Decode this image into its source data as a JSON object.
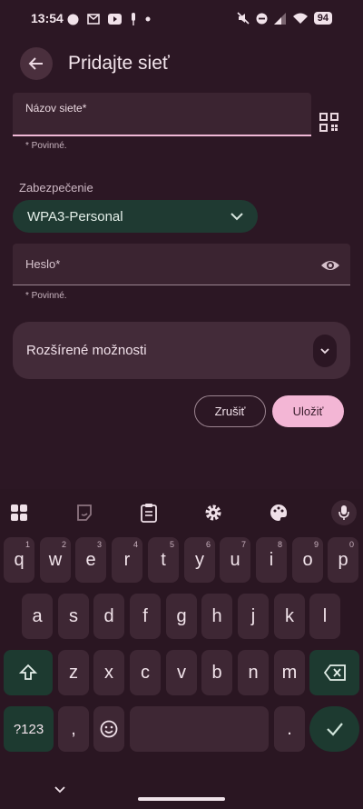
{
  "status_bar": {
    "time": "13:54",
    "battery": "94"
  },
  "header": {
    "title": "Pridajte sieť"
  },
  "form": {
    "ssid_label": "Názov siete*",
    "ssid_helper": "* Povinné.",
    "security_label": "Zabezpečenie",
    "security_value": "WPA3-Personal",
    "password_label": "Heslo*",
    "password_helper": "* Povinné.",
    "advanced_label": "Rozšírené možnosti",
    "cancel_label": "Zrušiť",
    "save_label": "Uložiť"
  },
  "keyboard": {
    "row1": [
      {
        "key": "q",
        "hint": "1"
      },
      {
        "key": "w",
        "hint": "2"
      },
      {
        "key": "e",
        "hint": "3"
      },
      {
        "key": "r",
        "hint": "4"
      },
      {
        "key": "t",
        "hint": "5"
      },
      {
        "key": "y",
        "hint": "6"
      },
      {
        "key": "u",
        "hint": "7"
      },
      {
        "key": "i",
        "hint": "8"
      },
      {
        "key": "o",
        "hint": "9"
      },
      {
        "key": "p",
        "hint": "0"
      }
    ],
    "row2": [
      "a",
      "s",
      "d",
      "f",
      "g",
      "h",
      "j",
      "k",
      "l"
    ],
    "row3": [
      "z",
      "x",
      "c",
      "v",
      "b",
      "n",
      "m"
    ],
    "symbols_label": "?123",
    "comma_label": ",",
    "period_label": "."
  },
  "colors": {
    "background": "#2c1724",
    "accent_pink": "#f3b6d5",
    "accent_green": "#1d3a30"
  }
}
